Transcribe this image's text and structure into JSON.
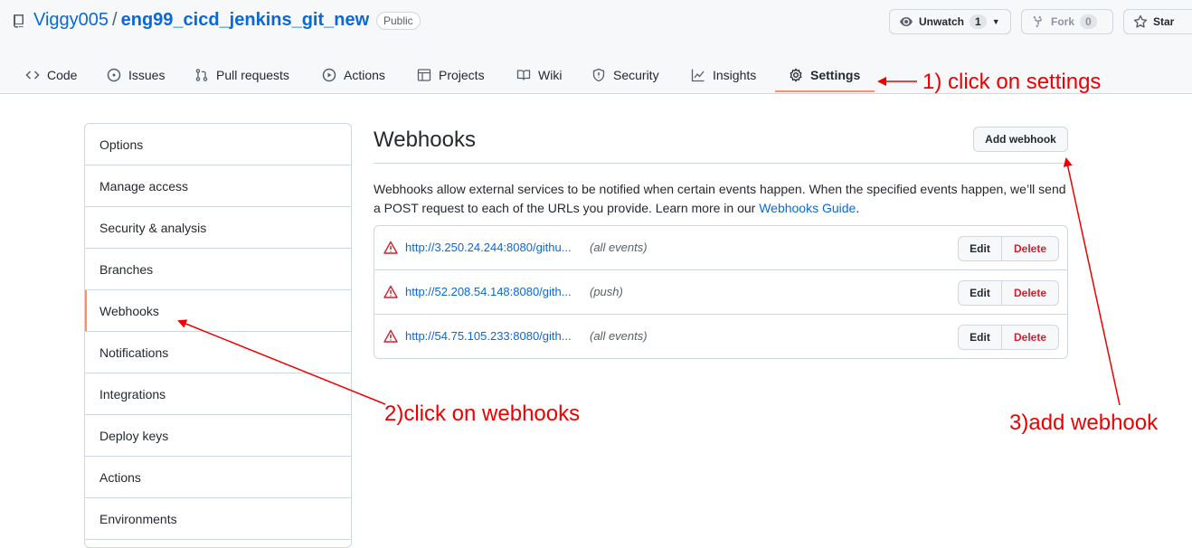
{
  "repo": {
    "owner": "Viggy005",
    "separator": "/",
    "name": "eng99_cicd_jenkins_git_new",
    "visibility": "Public"
  },
  "header_actions": {
    "watch": {
      "label": "Unwatch",
      "count": "1"
    },
    "fork": {
      "label": "Fork",
      "count": "0"
    },
    "star": {
      "label": "Star"
    }
  },
  "tabs": [
    {
      "label": "Code",
      "icon": "code-icon"
    },
    {
      "label": "Issues",
      "icon": "issue-icon"
    },
    {
      "label": "Pull requests",
      "icon": "pull-request-icon"
    },
    {
      "label": "Actions",
      "icon": "play-icon"
    },
    {
      "label": "Projects",
      "icon": "table-icon"
    },
    {
      "label": "Wiki",
      "icon": "book-icon"
    },
    {
      "label": "Security",
      "icon": "shield-icon"
    },
    {
      "label": "Insights",
      "icon": "graph-icon"
    },
    {
      "label": "Settings",
      "icon": "gear-icon",
      "active": true
    }
  ],
  "sidebar": {
    "items": [
      {
        "label": "Options"
      },
      {
        "label": "Manage access"
      },
      {
        "label": "Security & analysis"
      },
      {
        "label": "Branches"
      },
      {
        "label": "Webhooks",
        "selected": true
      },
      {
        "label": "Notifications"
      },
      {
        "label": "Integrations"
      },
      {
        "label": "Deploy keys"
      },
      {
        "label": "Actions"
      },
      {
        "label": "Environments"
      }
    ]
  },
  "main": {
    "title": "Webhooks",
    "add_button": "Add webhook",
    "description": "Webhooks allow external services to be notified when certain events happen. When the specified events happen, we’ll send a POST request to each of the URLs you provide. Learn more in our ",
    "guide_link": "Webhooks Guide",
    "description_end": ".",
    "hooks": [
      {
        "url": "http://3.250.24.244:8080/githu...",
        "events": "(all events)"
      },
      {
        "url": "http://52.208.54.148:8080/gith...",
        "events": "(push)"
      },
      {
        "url": "http://54.75.105.233:8080/gith...",
        "events": "(all events)"
      }
    ],
    "edit_label": "Edit",
    "delete_label": "Delete"
  },
  "annotations": {
    "step1": "1) click on settings",
    "step2": "2)click on webhooks",
    "step3": "3)add webhook"
  },
  "colors": {
    "accent": "#fd8c73",
    "link": "#0969da",
    "danger": "#cf222e",
    "annotation": "#e00000"
  }
}
